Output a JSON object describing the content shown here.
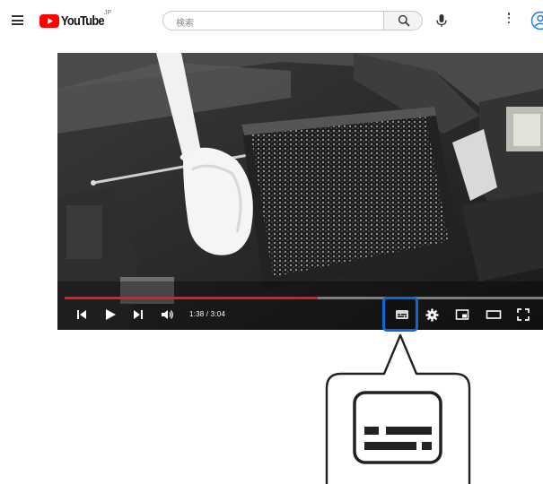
{
  "header": {
    "logo_text": "YouTube",
    "logo_sup": "JP",
    "search_placeholder": "検索",
    "icons": [
      "menu-icon",
      "youtube-logo-icon",
      "search-icon",
      "mic-icon",
      "more-vert-icon",
      "account-icon"
    ]
  },
  "player": {
    "time_display": "1:38 / 3:04",
    "progress": 0.53,
    "progress_color": "#e21b1b",
    "controls": [
      "previous-icon",
      "play-icon",
      "next-icon",
      "volume-icon",
      "subtitles-icon",
      "settings-icon",
      "miniplayer-icon",
      "theater-icon",
      "fullscreen-icon"
    ],
    "highlight_color": "#1565d8"
  },
  "callout": {
    "icon": "subtitles-icon"
  }
}
